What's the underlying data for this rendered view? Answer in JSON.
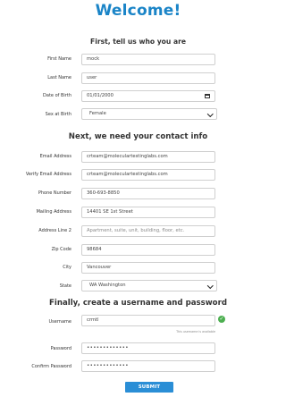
{
  "title": "Welcome!",
  "sections": {
    "about": "First, tell us who you are",
    "contact": "Next, we need your contact info",
    "account": "Finally, create a username and password"
  },
  "fields": {
    "first_name": {
      "label": "First Name",
      "value": "mock"
    },
    "last_name": {
      "label": "Last Name",
      "value": "user"
    },
    "dob": {
      "label": "Date of Birth",
      "value": "01/01/2000",
      "icon": "calendar-icon"
    },
    "sex": {
      "label": "Sex at Birth",
      "value": "Female"
    },
    "email": {
      "label": "Email Address",
      "value": "crteam@moleculartestinglabs.com"
    },
    "verify_email": {
      "label": "Verify Email Address",
      "value": "crteam@moleculartestinglabs.com"
    },
    "phone": {
      "label": "Phone Number",
      "value": "360-693-8850"
    },
    "mailing": {
      "label": "Mailing Address",
      "value": "14401 SE 1st Street"
    },
    "address2": {
      "label": "Address Line 2",
      "placeholder": "Apartment, suite, unit, building, floor, etc."
    },
    "zip": {
      "label": "Zip Code",
      "value": "98684"
    },
    "city": {
      "label": "City",
      "value": "Vancouver"
    },
    "state": {
      "label": "State",
      "value": "WA Washington"
    },
    "username": {
      "label": "Username",
      "value": "crmtl",
      "status": "This username is available",
      "status_color": "#4caf50"
    },
    "password": {
      "label": "Password",
      "value": "•••••••••••••"
    },
    "confirm_password": {
      "label": "Confirm Password",
      "value": "•••••••••••••"
    }
  },
  "submit_label": "SUBMIT",
  "colors": {
    "accent": "#1a84c7",
    "button": "#2a8ed6",
    "success": "#4caf50"
  }
}
